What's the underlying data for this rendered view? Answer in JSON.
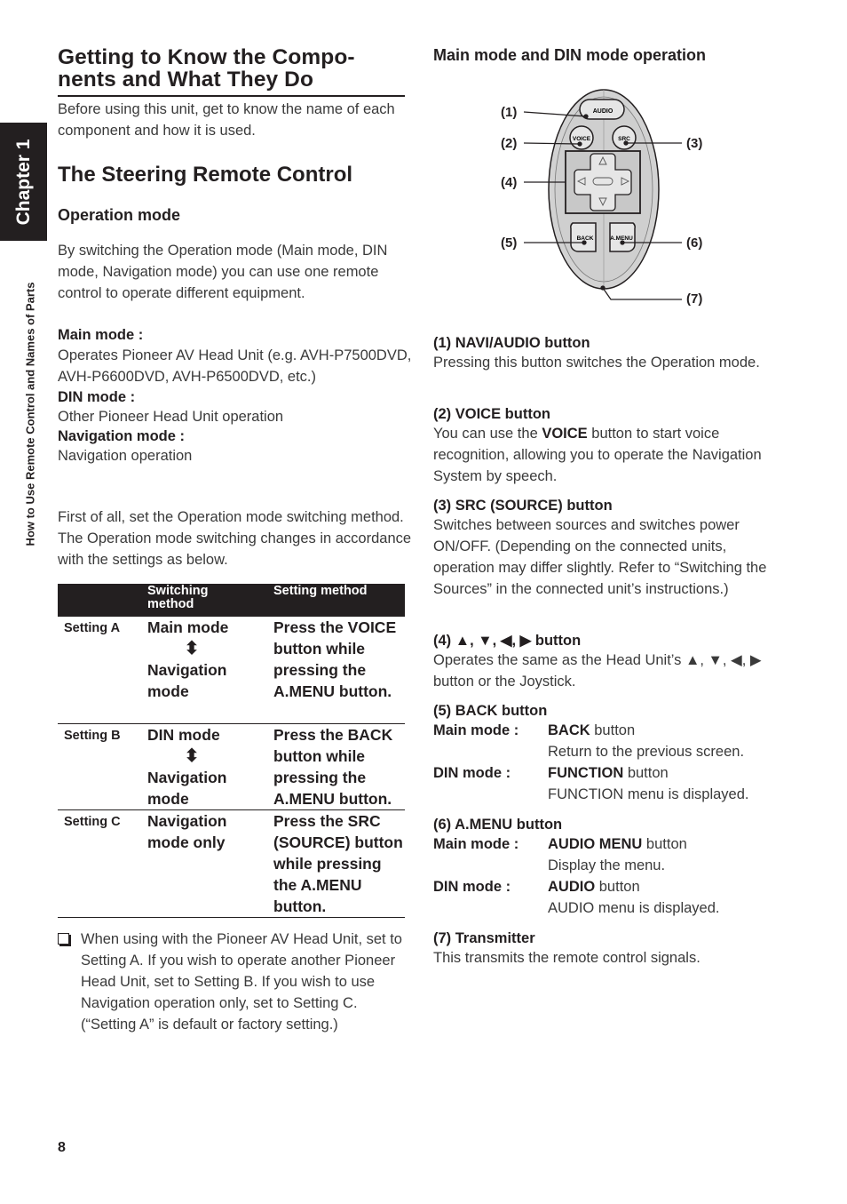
{
  "side": {
    "chapter": "Chapter 1",
    "section": "How to Use Remote Control and Names of Parts"
  },
  "left": {
    "title": "Getting to Know the Compo-nents and What They Do",
    "title_line1": "Getting to Know the Compo-",
    "title_line2": "nents and What They Do",
    "intro": "Before using this unit, get to know the name of each component and how it is used.",
    "section_title": "The Steering Remote Control",
    "subsection_title": "Operation mode",
    "operation_intro": "By switching the Operation mode (Main mode, DIN mode, Navigation mode) you can use one remote control to operate different equipment.",
    "modes": [
      {
        "label": "Main mode :",
        "desc": "Operates Pioneer AV Head Unit (e.g. AVH-P7500DVD, AVH-P6600DVD, AVH-P6500DVD, etc.)"
      },
      {
        "label": "DIN mode :",
        "desc": "Other Pioneer Head Unit operation"
      },
      {
        "label": "Navigation mode :",
        "desc": "Navigation operation"
      }
    ],
    "first_of_all": "First of all, set the Operation mode switching method. The Operation mode switching changes in accordance with the settings as below.",
    "table": {
      "headers": [
        "",
        "Switching method",
        "Setting method"
      ],
      "header_switching_l1": "Switching",
      "header_switching_l2": "method",
      "rows": [
        {
          "setting": "Setting A",
          "switch_from": "Main mode",
          "arrow": "⬍",
          "switch_to": "Navigation mode",
          "method": "Press the VOICE button while pressing the A.MENU button."
        },
        {
          "setting": "Setting B",
          "switch_from": "DIN mode",
          "arrow": "⬍",
          "switch_to": "Navigation mode",
          "method": "Press the BACK button while pressing the A.MENU button."
        },
        {
          "setting": "Setting C",
          "switch_from": "Navigation mode only",
          "arrow": "",
          "switch_to": "",
          "method": "Press the SRC (SOURCE) button while pressing the A.MENU button."
        }
      ]
    },
    "note": "When using with the Pioneer AV Head Unit, set to Setting A. If you wish to operate another Pioneer Head Unit, set to Setting B. If you wish to use Navigation operation only, set to Setting C. (“Setting A” is default or factory setting.)",
    "page_number": "8"
  },
  "right": {
    "title": "Main mode and DIN mode operation",
    "diagram": {
      "callouts": [
        "(1)",
        "(2)",
        "(3)",
        "(4)",
        "(5)",
        "(6)",
        "(7)"
      ],
      "buttons": {
        "audio": "AUDIO",
        "voice": "VOICE",
        "src": "SRC",
        "back": "BACK",
        "amenu": "A.MENU"
      }
    },
    "items": [
      {
        "title": "(1) NAVI/AUDIO button",
        "desc": "Pressing this button switches the Operation mode."
      },
      {
        "title": "(2) VOICE button",
        "desc_pre": "You can use the ",
        "desc_bold": "VOICE",
        "desc_post": " button to start voice recognition, allowing you to operate the Navigation System by speech."
      },
      {
        "title": "(3) SRC (SOURCE) button",
        "desc": "Switches between sources and switches power ON/OFF. (Depending on the connected units, operation may differ slightly. Refer to “Switching the Sources” in the connected unit’s instructions.)"
      },
      {
        "title": "(4) ▲, ▼, ◀, ▶ button",
        "desc": "Operates the same as the Head Unit’s ▲, ▼, ◀, ▶ button or the Joystick."
      },
      {
        "title": "(5) BACK button",
        "rows": [
          {
            "mode": "Main mode :",
            "button": "BACK",
            "suffix": " button",
            "desc": "Return to the previous screen."
          },
          {
            "mode": "DIN mode :",
            "button": "FUNCTION",
            "suffix": " button",
            "desc": "FUNCTION menu is displayed."
          }
        ]
      },
      {
        "title": "(6) A.MENU button",
        "rows": [
          {
            "mode": "Main mode :",
            "button": "AUDIO MENU",
            "suffix": " button",
            "desc": "Display the menu."
          },
          {
            "mode": "DIN mode :",
            "button": "AUDIO",
            "suffix": " button",
            "desc": "AUDIO menu is displayed."
          }
        ]
      },
      {
        "title": "(7) Transmitter",
        "desc": "This transmits the remote control signals."
      }
    ]
  }
}
